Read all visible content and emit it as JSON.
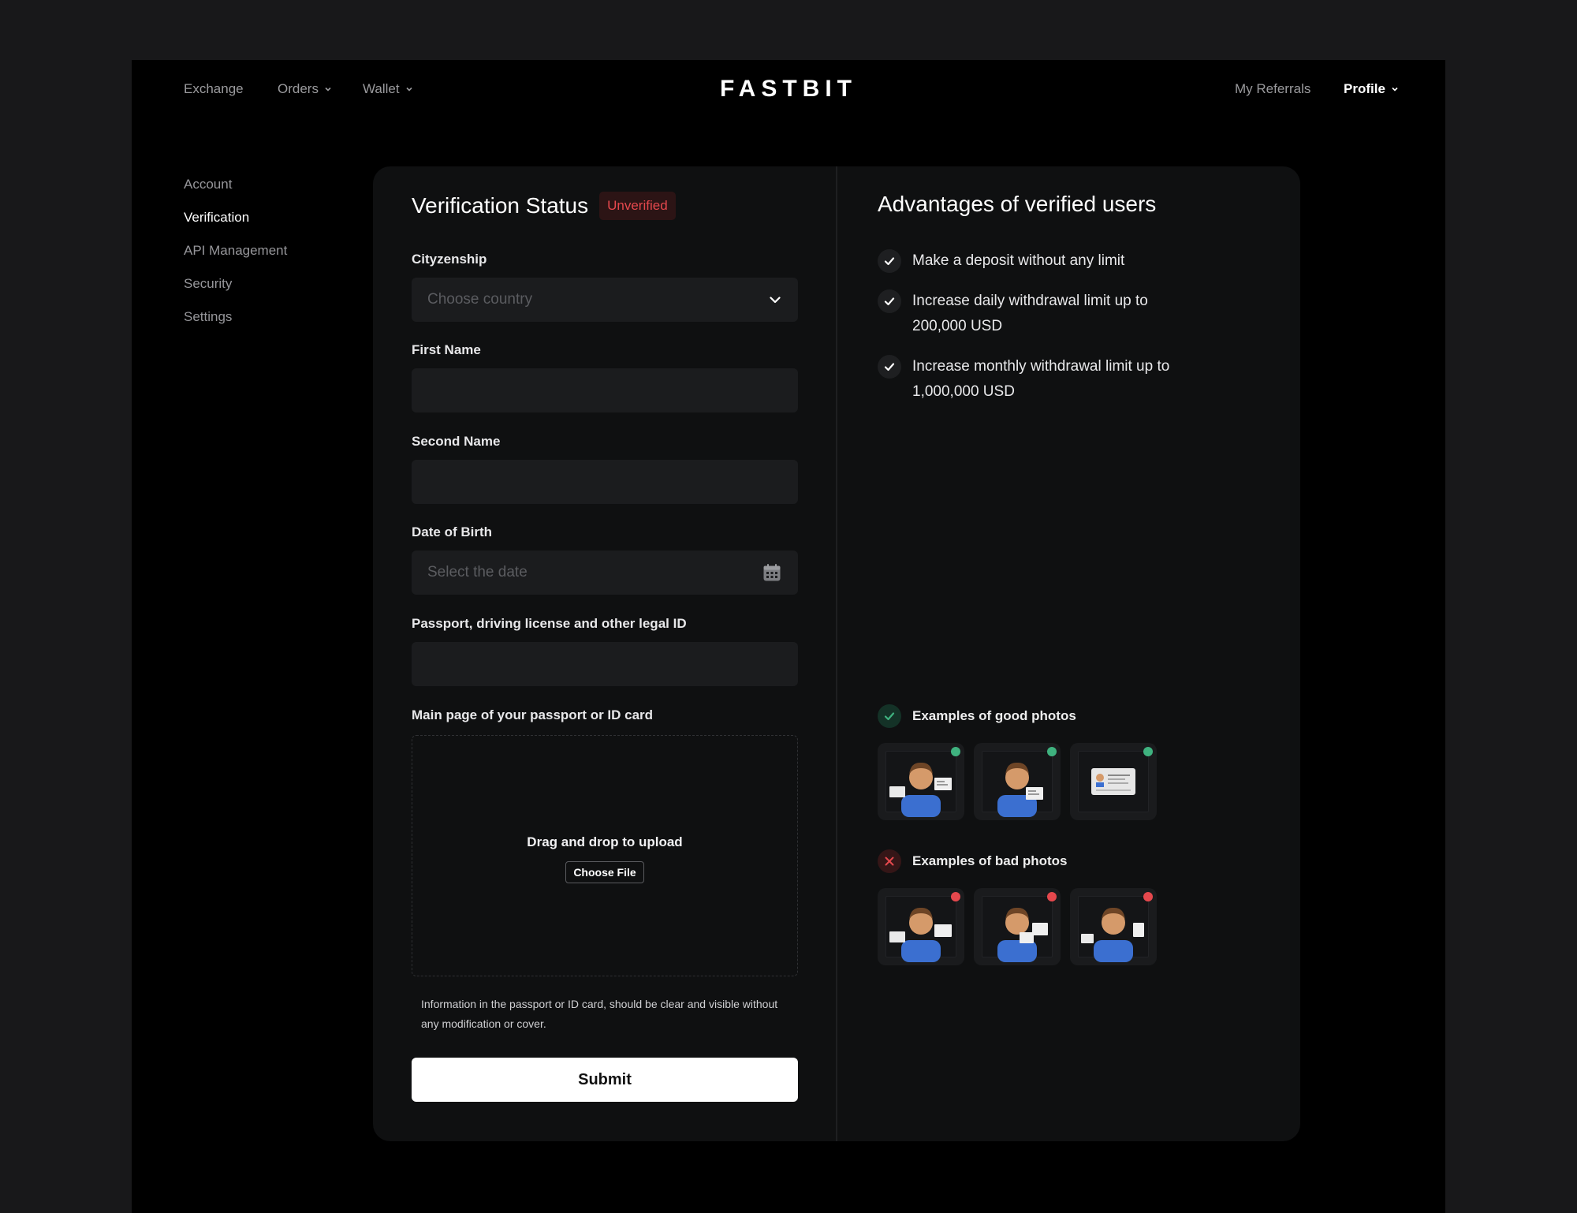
{
  "nav": {
    "left": [
      {
        "label": "Exchange",
        "dropdown": false
      },
      {
        "label": "Orders",
        "dropdown": true
      },
      {
        "label": "Wallet",
        "dropdown": true
      }
    ],
    "brand": "FASTBIT",
    "referrals": "My Referrals",
    "profile": "Profile"
  },
  "sidebar": {
    "items": [
      "Account",
      "Verification",
      "API Management",
      "Security",
      "Settings"
    ],
    "active": "Verification"
  },
  "form": {
    "title": "Verification Status",
    "status_badge": "Unverified",
    "citizenship_label": "Cityzenship",
    "citizenship_placeholder": "Choose country",
    "first_name_label": "First Name",
    "first_name_value": "",
    "second_name_label": "Second Name",
    "second_name_value": "",
    "dob_label": "Date of Birth",
    "dob_placeholder": "Select the date",
    "legal_id_label": "Passport, driving license and other legal ID",
    "legal_id_value": "",
    "upload_label": "Main page of your passport or ID card",
    "upload_title": "Drag and drop to upload",
    "choose_file": "Choose File",
    "hint": "Information in the passport or ID card, should be clear and visible without any modification or cover.",
    "submit": "Submit"
  },
  "advantages": {
    "title": "Advantages of verified users",
    "items": [
      "Make a deposit without any limit",
      "Increase daily withdrawal limit up to 200,000 USD",
      "Increase monthly withdrawal limit up to 1,000,000 USD"
    ],
    "good_title": "Examples of good photos",
    "bad_title": "Examples of bad photos"
  },
  "colors": {
    "background": "#000000",
    "card": "#0f1011",
    "input": "#1b1c1e",
    "danger": "#e5484d",
    "success": "#3fb27f"
  }
}
